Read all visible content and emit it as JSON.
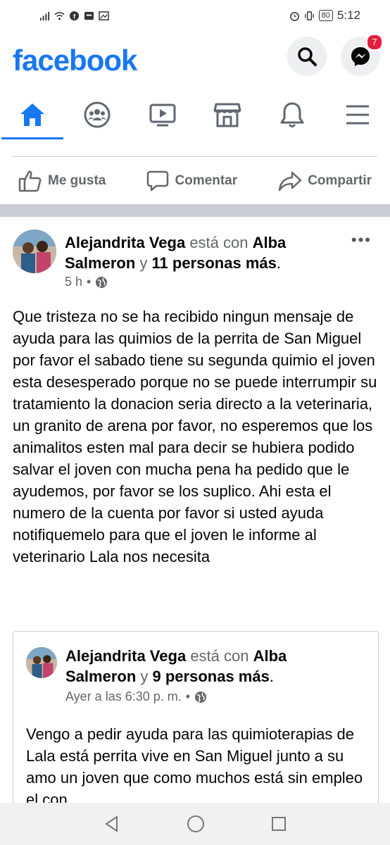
{
  "status": {
    "time": "5:12",
    "battery": "80"
  },
  "header": {
    "logo": "facebook",
    "messenger_badge": "7"
  },
  "tabs": [
    {
      "name": "home-icon"
    },
    {
      "name": "groups-icon"
    },
    {
      "name": "watch-icon"
    },
    {
      "name": "marketplace-icon"
    },
    {
      "name": "bell-icon"
    },
    {
      "name": "menu-icon"
    }
  ],
  "actions": {
    "like": "Me gusta",
    "comment": "Comentar",
    "share": "Compartir"
  },
  "post": {
    "author": "Alejandrita Vega",
    "with_word": "está con",
    "tagged": "Alba Salmeron",
    "and_word": "y",
    "others": "11 personas más",
    "time": "5 h",
    "text": "Que tristeza no se ha recibido ningun mensaje de ayuda para las quimios de la perrita de San Miguel por favor el sabado tiene su segunda quimio el joven esta desesperado porque no se puede interrumpir su tratamiento la donacion seria directo a la veterinaria, un granito de arena por favor, no esperemos que los animalitos esten mal para decir se hubiera podido salvar el joven con mucha pena ha pedido que le ayudemos, por favor se los suplico. Ahi esta el numero de la cuenta por favor si usted ayuda notifiquemelo para que el joven le informe al veterinario Lala nos necesita"
  },
  "shared": {
    "author": "Alejandrita Vega",
    "with_word": "está con",
    "tagged": "Alba Salmeron",
    "and_word": "y",
    "others": "9 personas más",
    "time": "Ayer a las 6:30 p. m.",
    "text": "Vengo a pedir ayuda para las quimioterapias de Lala está perrita vive en San Miguel junto a su amo un joven que como muchos está sin empleo el con"
  },
  "colors": {
    "brand": "#1877f2",
    "badge": "#e41e3f"
  }
}
